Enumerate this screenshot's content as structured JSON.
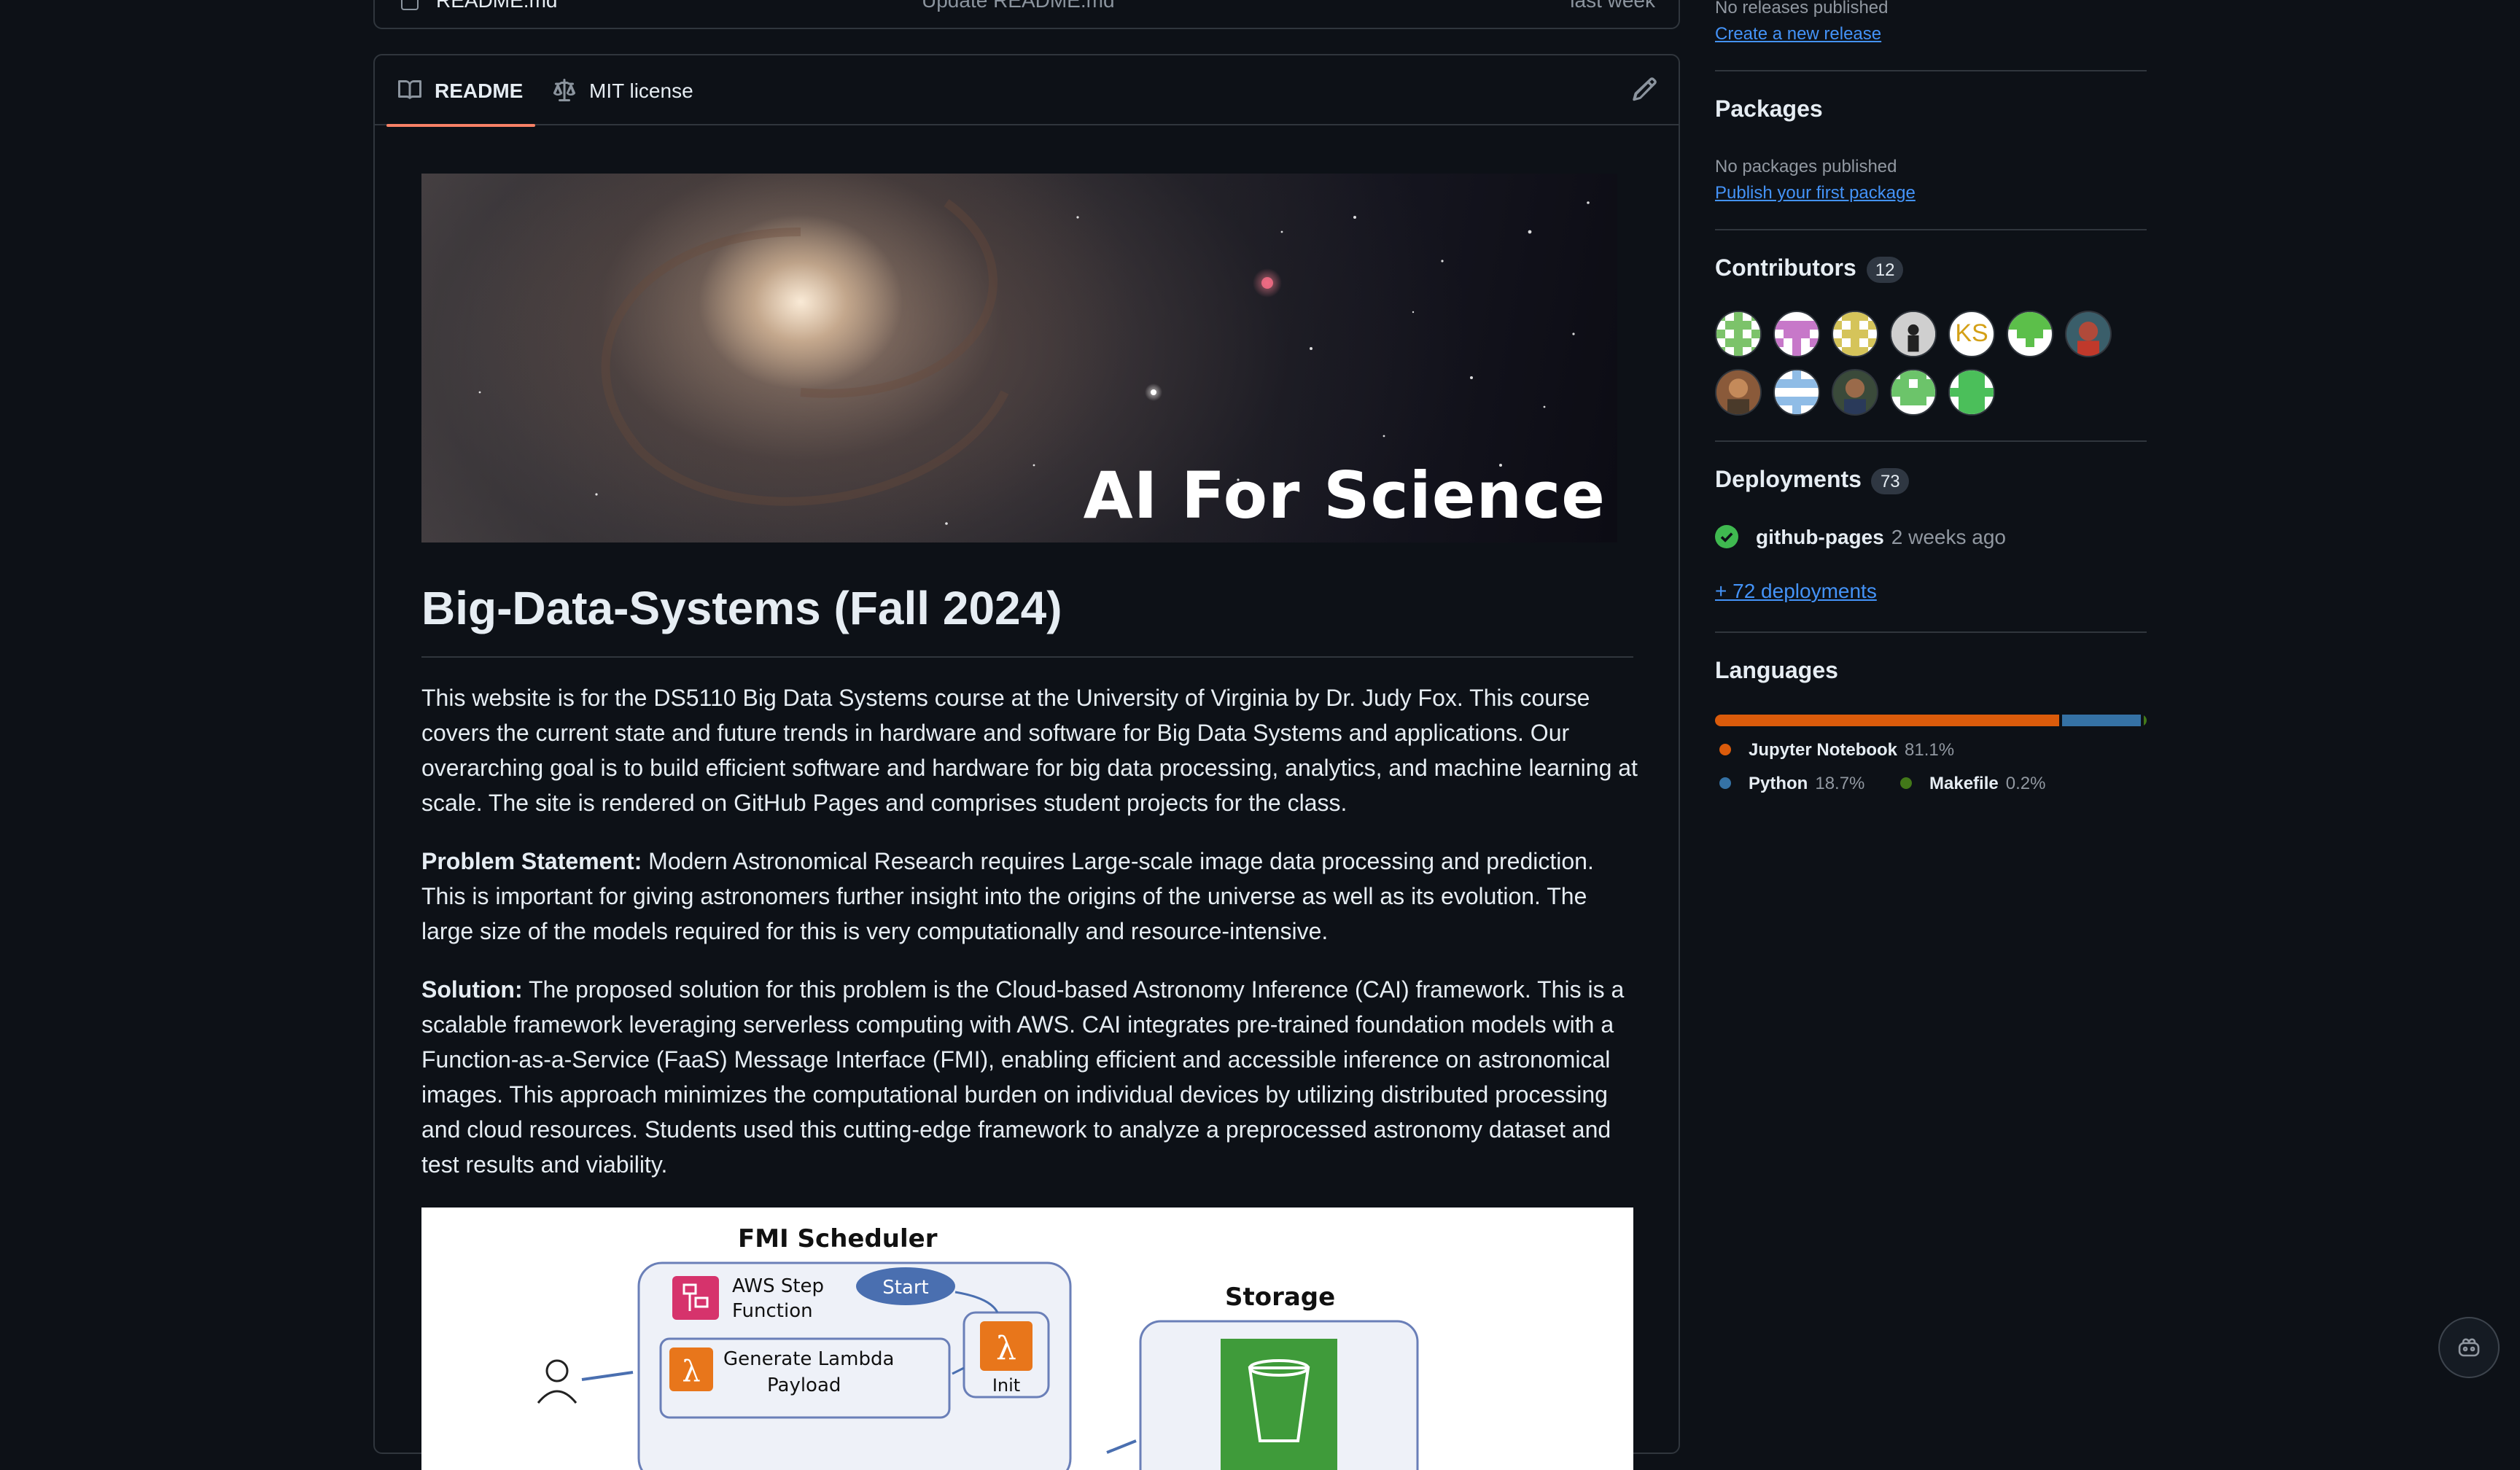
{
  "file_row": {
    "name": "README.md",
    "commit": "Update README.md",
    "age": "last week"
  },
  "readme_tabs": [
    {
      "label": "README",
      "icon": "book-icon",
      "active": true
    },
    {
      "label": "MIT license",
      "icon": "law-icon",
      "active": false
    }
  ],
  "banner": {
    "text": "AI For Science"
  },
  "readme": {
    "title": "Big-Data-Systems (Fall 2024)",
    "intro": "This website is for the DS5110 Big Data Systems course at the University of Virginia by Dr. Judy Fox. This course covers the current state and future trends in hardware and software for Big Data Systems and applications. Our overarching goal is to build efficient software and hardware for big data processing, analytics, and machine learning at scale. The site is rendered on GitHub Pages and comprises student projects for the class.",
    "problem_label": "Problem Statement:",
    "problem_text": " Modern Astronomical Research requires Large-scale image data processing and prediction. This is important for giving astronomers further insight into the origins of the universe as well as its evolution. The large size of the models required for this is very computationally and resource-intensive.",
    "solution_label": "Solution:",
    "solution_text": " The proposed solution for this problem is the Cloud-based Astronomy Inference (CAI) framework. This is a scalable framework leveraging serverless computing with AWS. CAI integrates pre-trained foundation models with a Function-as-a-Service (FaaS) Message Interface (FMI), enabling efficient and accessible inference on astronomical images. This approach minimizes the computational burden on individual devices by utilizing distributed processing and cloud resources. Students used this cutting-edge framework to analyze a preprocessed astronomy dataset and test results and viability."
  },
  "diagram": {
    "scheduler_title": "FMI Scheduler",
    "step_function": "AWS Step\nFunction",
    "start": "Start",
    "init": "Init",
    "payload": "Generate Lambda\nPayload",
    "storage": "Storage"
  },
  "sidebar": {
    "releases_status": "No releases published",
    "releases_link": "Create a new release",
    "packages_title": "Packages",
    "packages_status": "No packages published",
    "packages_link": "Publish your first package",
    "contributors_title": "Contributors",
    "contributors_count": "12",
    "contributor_initials": "KS",
    "deployments_title": "Deployments",
    "deployments_count": "73",
    "deployment_name": "github-pages",
    "deployment_age": "2 weeks ago",
    "more_deployments": "+ 72 deployments",
    "languages_title": "Languages",
    "languages": [
      {
        "name": "Jupyter Notebook",
        "percent": "81.1%",
        "value": 81.1,
        "color": "#DA5B0B"
      },
      {
        "name": "Python",
        "percent": "18.7%",
        "value": 18.7,
        "color": "#3572A5"
      },
      {
        "name": "Makefile",
        "percent": "0.2%",
        "value": 0.2,
        "color": "#427819"
      }
    ]
  }
}
